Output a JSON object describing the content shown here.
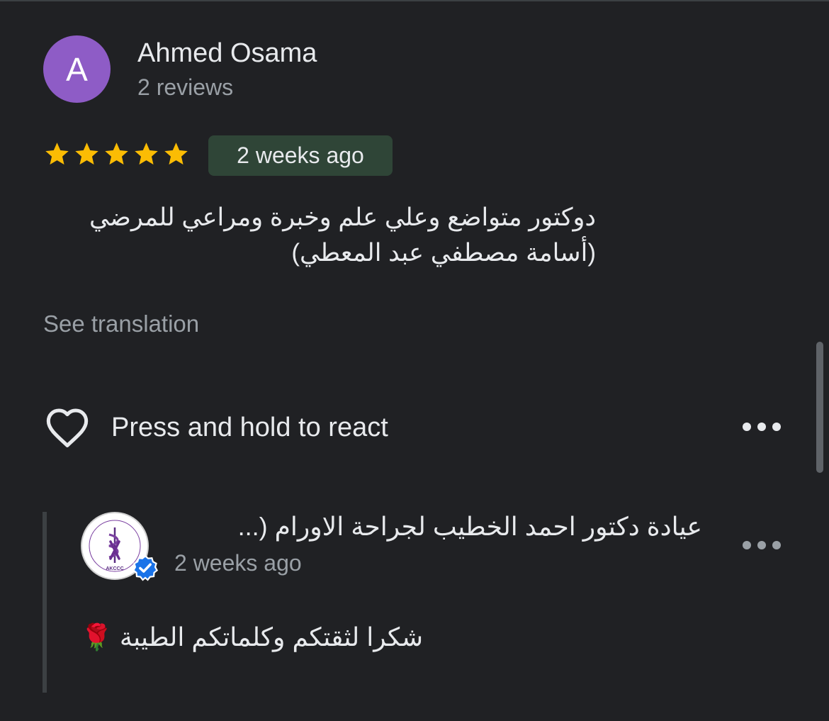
{
  "review": {
    "author": {
      "initial": "A",
      "name": "Ahmed Osama",
      "review_count": "2 reviews",
      "avatar_color": "#8e5cc6"
    },
    "rating": 5,
    "max_rating": 5,
    "time_ago": "2 weeks ago",
    "text_lines": [
      "دوكتور متواضع وعلي علم وخبرة ومراعي للمرضي",
      "(أسامة مصطفي عبد المعطي)"
    ],
    "see_translation": "See translation",
    "react_label": "Press and hold to react",
    "more_icon": "more-horizontal-icon"
  },
  "owner_response": {
    "name": "عيادة دكتور احمد الخطيب لجراحة الاورام (...",
    "time_ago": "2 weeks ago",
    "text": "شكرا لثقتكم وكلماتكم الطيبة 🌹",
    "logo_text": "AKCCC",
    "verified_icon": "verified-badge-icon",
    "more_icon": "more-horizontal-icon"
  },
  "colors": {
    "background": "#202124",
    "star": "#fbbc04",
    "badge_bg": "#2f4537",
    "verified": "#1a73e8"
  }
}
